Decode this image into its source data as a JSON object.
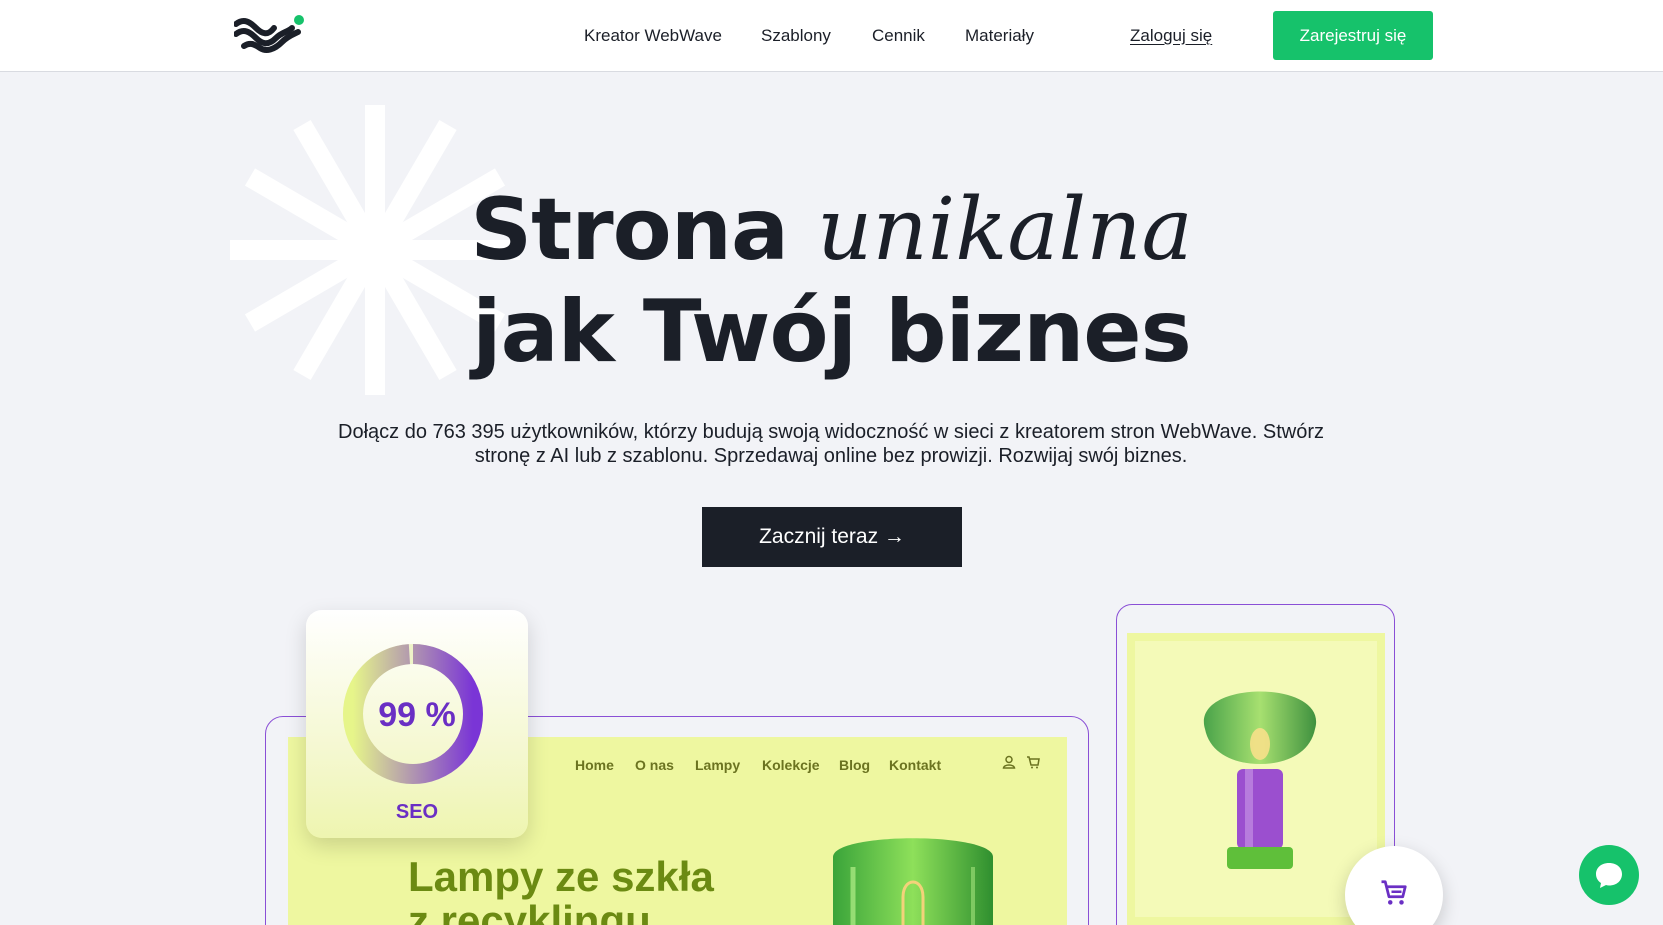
{
  "header": {
    "logo_name": "webwave-logo",
    "nav": [
      {
        "label": "Kreator WebWave"
      },
      {
        "label": "Szablony"
      },
      {
        "label": "Cennik"
      },
      {
        "label": "Materiały"
      }
    ],
    "login_label": "Zaloguj się",
    "signup_label": "Zarejestruj się"
  },
  "hero": {
    "title_word1": "Strona",
    "title_italic": "unikalna",
    "title_line2": "jak Twój biznes",
    "description": "Dołącz do 763 395 użytkowników, którzy budują swoją widoczność w sieci z kreatorem stron WebWave. Stwórz stronę z AI lub z szablonu. Sprzedawaj online bez prowizji. Rozwijaj swój biznes.",
    "cta_label": "Zacznij teraz →"
  },
  "seo_card": {
    "percent_text": "99 %",
    "percent_value": 0.99,
    "label": "SEO"
  },
  "site_preview": {
    "nav": [
      "Home",
      "O nas",
      "Lampy",
      "Kolekcje",
      "Blog",
      "Kontakt"
    ],
    "heading_line1": "Lampy ze szkła",
    "heading_line2": "z recyklingu",
    "icons": [
      "user-icon",
      "cart-icon"
    ]
  },
  "widgets": {
    "cart_icon": "cart-icon",
    "chat_icon": "chat-icon"
  },
  "colors": {
    "brand_green": "#16c26b",
    "dark": "#1b1f28",
    "purple": "#6a2fc4",
    "lime": "#eef7a0"
  }
}
